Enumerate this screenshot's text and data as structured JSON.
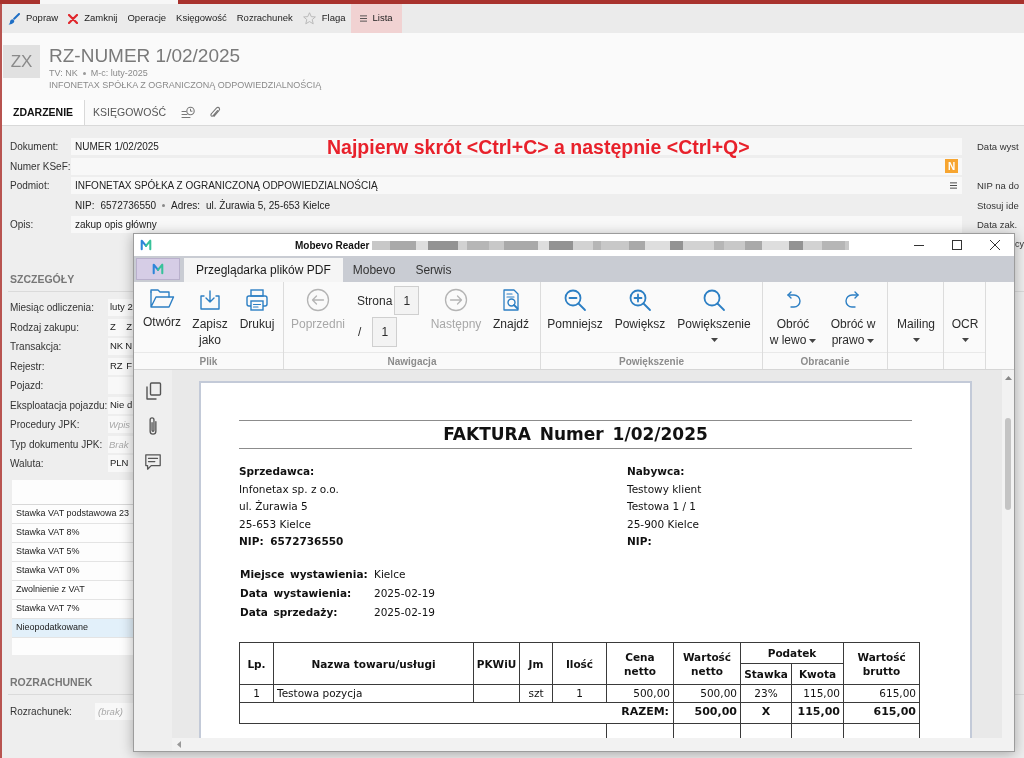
{
  "toolbar": [
    {
      "label": "Popraw",
      "selected": false
    },
    {
      "label": "Zamknij",
      "selected": false
    },
    {
      "label": "Operacje",
      "selected": false
    },
    {
      "label": "Księgowość",
      "selected": false
    },
    {
      "label": "Rozrachunek",
      "selected": false
    },
    {
      "label": "Flaga",
      "selected": false
    },
    {
      "label": "Lista",
      "selected": true
    }
  ],
  "header": {
    "avatar": "ZX",
    "title": "RZ-NUMER 1/02/2025",
    "meta": [
      "TV: NK",
      "M-c: luty-2025"
    ],
    "company": "INFONETAX SPÓŁKA Z OGRANICZONĄ ODPOWIEDZIALNOŚCIĄ"
  },
  "tabs": [
    {
      "kind": "text",
      "label": "ZDARZENIE",
      "selected": true
    },
    {
      "kind": "text",
      "label": "KSIĘGOWOŚĆ",
      "selected": false
    },
    {
      "kind": "icon",
      "selected": false
    },
    {
      "kind": "icon",
      "selected": false
    }
  ],
  "annotation": {
    "text": "Najpierw skrót <Ctrl+C> a następnie <Ctrl+Q>"
  },
  "form": {
    "rows": [
      {
        "kind": "field",
        "label": "Dokument:",
        "value": "NUMER 1/02/2025",
        "side_label": "Data wyst"
      },
      {
        "kind": "field",
        "label": "Numer KSeF:",
        "badge": "N"
      },
      {
        "kind": "field",
        "label": "Podmiot:",
        "value": "INFONETAX SPÓŁKA Z OGRANICZONĄ ODPOWIEDZIALNOŚCIĄ",
        "menu": true,
        "side_label": "NIP na do"
      },
      {
        "kind": "details",
        "parts": [
          {
            "label": "NIP:",
            "value": "6572736550"
          },
          {
            "label": "Adres:",
            "value": "ul. Żurawia 5, 25-653 Kielce"
          }
        ],
        "side_label": "Stosuj ide"
      },
      {
        "kind": "field",
        "label": "Opis:",
        "value": "zakup opis główny",
        "side_label": "Data zak."
      }
    ],
    "side_label_cut": "cy"
  },
  "details": {
    "title": "SZCZEGÓŁY",
    "rows": [
      {
        "label": "Miesiąc odliczenia:",
        "values": [
          "luty 2"
        ]
      },
      {
        "label": "Rodzaj zakupu:",
        "values": [
          "Z",
          "Z"
        ]
      },
      {
        "label": "Transakcja:",
        "values": [
          "NK",
          "N"
        ]
      },
      {
        "label": "Rejestr:",
        "values": [
          "RZ",
          "F"
        ]
      },
      {
        "label": "Pojazd:"
      },
      {
        "label": "Eksploatacja pojazdu:",
        "values": [
          "Nie d"
        ]
      },
      {
        "label": "Procedury JPK:",
        "placeholder": "Wpis"
      },
      {
        "label": "Typ dokumentu JPK:",
        "placeholder": "Brak"
      },
      {
        "label": "Waluta:",
        "values": [
          "PLN"
        ]
      }
    ]
  },
  "vat_table": {
    "rows": [
      {
        "label": "Stawka VAT podstawowa 23",
        "selected": false
      },
      {
        "label": "Stawka VAT 8%",
        "selected": false
      },
      {
        "label": "Stawka VAT 5%",
        "selected": false
      },
      {
        "label": "Stawka VAT 0%",
        "selected": false
      },
      {
        "label": "Zwolnienie z VAT",
        "selected": false
      },
      {
        "label": "Stawka VAT 7%",
        "selected": false
      },
      {
        "label": "Nieopodatkowane",
        "selected": true
      }
    ]
  },
  "settlement": {
    "title": "ROZRACHUNEK",
    "label": "Rozrachunek:",
    "placeholder": "(brak)"
  },
  "reader": {
    "title": "Mobevo Reader",
    "tabs": [
      {
        "label": "Przeglądarka plików PDF",
        "selected": true
      },
      {
        "label": "Mobevo",
        "selected": false
      },
      {
        "label": "Serwis",
        "selected": false
      }
    ],
    "ribbon": [
      {
        "label": "Plik",
        "items": [
          {
            "kind": "button",
            "lines": [
              "Otwórz"
            ],
            "disabled": false
          },
          {
            "kind": "button",
            "lines": [
              "Zapisz",
              "jako"
            ],
            "disabled": false
          },
          {
            "kind": "button",
            "lines": [
              "Drukuj"
            ],
            "disabled": false
          }
        ]
      },
      {
        "label": "Nawigacja",
        "items": [
          {
            "kind": "button",
            "lines": [
              "Poprzedni"
            ],
            "disabled": true
          },
          {
            "kind": "pager",
            "label": "Strona",
            "value": "1",
            "separator": "/",
            "total": "1"
          },
          {
            "kind": "button",
            "lines": [
              "Następny"
            ],
            "disabled": true
          },
          {
            "kind": "button",
            "lines": [
              "Znajdź"
            ],
            "disabled": false
          }
        ]
      },
      {
        "label": "Powiększenie",
        "items": [
          {
            "kind": "button",
            "lines": [
              "Pomniejsz"
            ],
            "disabled": false
          },
          {
            "kind": "button",
            "lines": [
              "Powiększ"
            ],
            "disabled": false
          },
          {
            "kind": "button",
            "lines": [
              "Powiększenie"
            ],
            "disabled": false,
            "dropdown": true
          }
        ]
      },
      {
        "label": "Obracanie",
        "items": [
          {
            "kind": "button",
            "lines": [
              "Obróć",
              "w lewo"
            ],
            "disabled": false,
            "dropdown": true
          },
          {
            "kind": "button",
            "lines": [
              "Obróć w",
              "prawo"
            ],
            "disabled": false,
            "dropdown": true
          }
        ]
      },
      {
        "items": [
          {
            "kind": "menu",
            "lines": [
              "Mailing"
            ],
            "dropdown": true
          }
        ]
      },
      {
        "items": [
          {
            "kind": "menu",
            "lines": [
              "OCR"
            ],
            "dropdown": true
          }
        ]
      }
    ],
    "document": {
      "title": "FAKTURA Numer 1/02/2025",
      "parties": [
        {
          "heading": "Sprzedawca:",
          "lines": [
            "Infonetax sp. z o.o.",
            "ul. Żurawia 5",
            "25-653 Kielce"
          ],
          "nip": "NIP: 6572736550"
        },
        {
          "heading": "Nabywca:",
          "lines": [
            "Testowy klient",
            "Testowa 1 / 1",
            "25-900 Kielce"
          ],
          "nip": "NIP:"
        }
      ],
      "meta": [
        {
          "label": "Miejsce wystawienia:",
          "value": "Kielce"
        },
        {
          "label": "Data wystawienia:",
          "value": "2025-02-19"
        },
        {
          "label": "Data sprzedaży:",
          "value": "2025-02-19"
        }
      ],
      "table": {
        "header_rows": [
          [
            {
              "label": "Lp.",
              "rowspan": 2
            },
            {
              "label": "Nazwa towaru/usługi",
              "rowspan": 2
            },
            {
              "label": "PKWiU",
              "rowspan": 2
            },
            {
              "label": "Jm",
              "rowspan": 2
            },
            {
              "label": "Ilość",
              "rowspan": 2
            },
            {
              "label": "Cena netto",
              "rowspan": 2
            },
            {
              "label": "Wartość netto",
              "rowspan": 2
            },
            {
              "label": "Podatek",
              "colspan": 2
            },
            {
              "label": "Wartość brutto",
              "rowspan": 2
            }
          ],
          [
            {
              "label": "Stawka"
            },
            {
              "label": "Kwota"
            }
          ]
        ],
        "rows": [
          [
            "1",
            "Testowa pozycja",
            null,
            "szt",
            "1",
            "500,00",
            "500,00",
            "23%",
            "115,00",
            "615,00"
          ]
        ],
        "total": {
          "label": "RAZEM:",
          "colspan": 6,
          "values": [
            "500,00",
            "X",
            "115,00",
            "615,00"
          ]
        }
      }
    }
  }
}
